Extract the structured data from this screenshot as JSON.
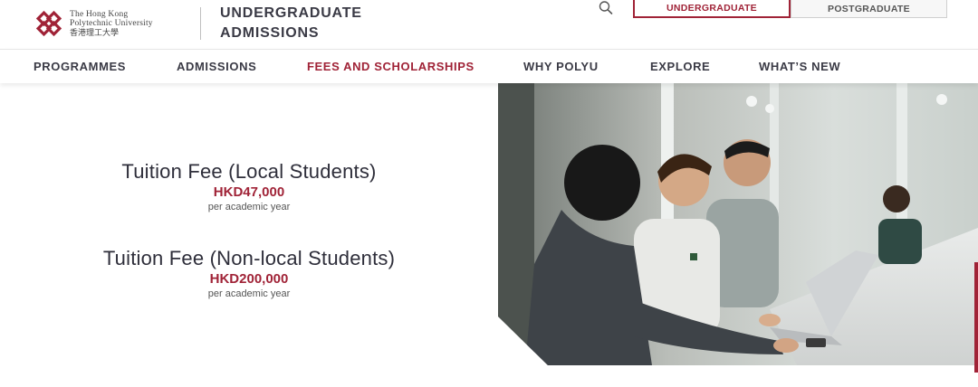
{
  "header": {
    "logo": {
      "name_en_line1": "The Hong Kong",
      "name_en_line2": "Polytechnic University",
      "name_zh": "香港理工大學"
    },
    "site_title_line1": "UNDERGRADUATE",
    "site_title_line2": "ADMISSIONS",
    "search_icon": "search-icon",
    "level_tabs": [
      {
        "label": "UNDERGRADUATE",
        "active": true
      },
      {
        "label": "POSTGRADUATE",
        "active": false
      }
    ]
  },
  "nav": {
    "items": [
      {
        "label": "PROGRAMMES"
      },
      {
        "label": "ADMISSIONS"
      },
      {
        "label": "FEES AND SCHOLARSHIPS",
        "active": true
      },
      {
        "label": "WHY POLYU"
      },
      {
        "label": "EXPLORE"
      },
      {
        "label": "WHAT’S NEW"
      }
    ]
  },
  "fees": [
    {
      "title": "Tuition Fee (Local Students)",
      "amount": "HKD47,000",
      "note": "per academic year"
    },
    {
      "title": "Tuition Fee (Non-local Students)",
      "amount": "HKD200,000",
      "note": "per academic year"
    }
  ],
  "colors": {
    "brand": "#a02337",
    "text": "#2e2e3a"
  }
}
